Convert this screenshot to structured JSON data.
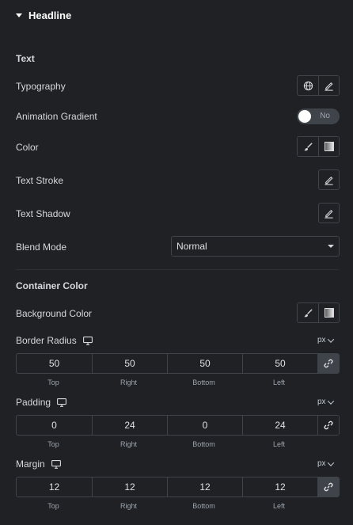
{
  "section": {
    "title": "Headline"
  },
  "text_heading": "Text",
  "typography": {
    "label": "Typography"
  },
  "animation_gradient": {
    "label": "Animation Gradient",
    "toggle": "No"
  },
  "color": {
    "label": "Color"
  },
  "text_stroke": {
    "label": "Text Stroke"
  },
  "text_shadow": {
    "label": "Text Shadow"
  },
  "blend_mode": {
    "label": "Blend Mode",
    "value": "Normal"
  },
  "container_heading": "Container Color",
  "background_color": {
    "label": "Background Color"
  },
  "border_radius": {
    "label": "Border Radius",
    "unit": "px",
    "values": [
      "50",
      "50",
      "50",
      "50"
    ],
    "labels": [
      "Top",
      "Right",
      "Bottom",
      "Left"
    ]
  },
  "padding": {
    "label": "Padding",
    "unit": "px",
    "values": [
      "0",
      "24",
      "0",
      "24"
    ],
    "labels": [
      "Top",
      "Right",
      "Bottom",
      "Left"
    ]
  },
  "margin": {
    "label": "Margin",
    "unit": "px",
    "values": [
      "12",
      "12",
      "12",
      "12"
    ],
    "labels": [
      "Top",
      "Right",
      "Bottom",
      "Left"
    ]
  },
  "icons": [
    "globe-icon",
    "pencil-icon",
    "brush-icon",
    "gradient-icon",
    "desktop-icon",
    "link-icon",
    "caret-down-icon"
  ]
}
